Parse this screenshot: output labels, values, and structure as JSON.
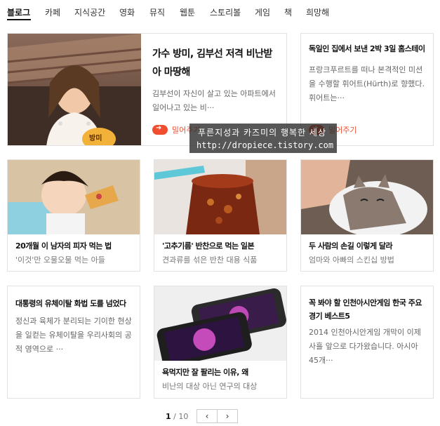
{
  "nav": [
    {
      "label": "블로그",
      "active": true
    },
    {
      "label": "카페"
    },
    {
      "label": "지식공간"
    },
    {
      "label": "영화"
    },
    {
      "label": "뮤직"
    },
    {
      "label": "웹툰"
    },
    {
      "label": "스토리볼"
    },
    {
      "label": "게임"
    },
    {
      "label": "책"
    },
    {
      "label": "희망해"
    }
  ],
  "featured": {
    "title": "가수 방미, 김부선 저격 비난받아 마땅해",
    "desc": "김부선이 자신이 살고 있는 아파트에서 일어나고 있는 비···",
    "push_label": "밀어주기",
    "thumb_badge": "방미"
  },
  "side": {
    "title": "독일인 집에서 보낸 2박 3일 홈스테이",
    "desc": "프랑크푸르트를 떠나 본격적인 미션을 수행할 휘어트(Hürth)로 향했다. 휘어트는···",
    "push_label": "밀어주기"
  },
  "watermark": {
    "line1": "푸른지성과 카즈미의 행복한 세상",
    "line2": "http://dropiece.tistory.com"
  },
  "cards_row2": [
    {
      "title": "20개월 이 남자의 피자 먹는 법",
      "sub": "'이것'만 오물오물 먹는 아들"
    },
    {
      "title": "'고추기름' 반찬으로 먹는 일본",
      "sub": "견과류를 섞은 반찬 대용 식품"
    },
    {
      "title": "두 사람의 손길 이렇게 달라",
      "sub": "엄마와 아빠의 스킨십 방법"
    }
  ],
  "cards_row3": [
    {
      "title": "대통령의 유체이탈 화법 도를 넘었다",
      "desc": "정신과 육체가 분리되는 기이한 현상을 일컫는 유체이탈을 우리사회의 공적 영역으로 ···"
    },
    {
      "title": "욕먹지만 잘 팔리는 이유, 왜",
      "sub": "비난의 대상 아닌 연구의 대상"
    },
    {
      "title": "꼭 봐야 할 인천아시안게임 한국 주요 경기 베스트5",
      "desc": "2014 인천아시안게임 개막이 이제 사흘 앞으로 다가왔습니다. 아시아 45개···"
    }
  ],
  "pagination": {
    "current": "1",
    "total": "/ 10",
    "prev": "‹",
    "next": "›"
  },
  "colors": {
    "accent": "#f04e2f",
    "border": "#e2e2e2"
  }
}
